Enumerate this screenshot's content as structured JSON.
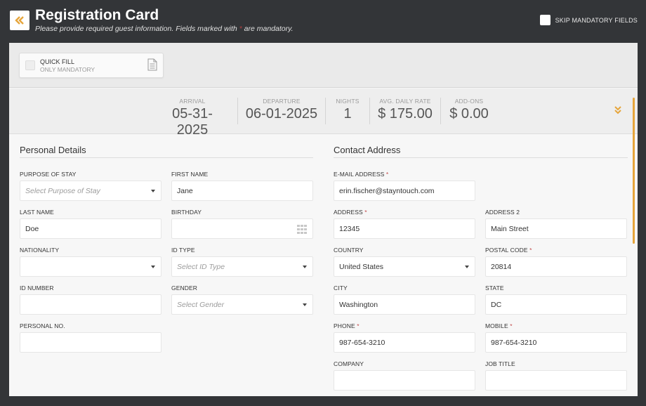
{
  "header": {
    "title": "Registration Card",
    "subtitle_pre": "Please provide required guest information. Fields marked with ",
    "subtitle_star": "*",
    "subtitle_post": " are mandatory.",
    "skip_label": "SKIP MANDATORY FIELDS"
  },
  "quick_fill": {
    "label": "QUICK FILL",
    "sublabel": "ONLY MANDATORY"
  },
  "stay": {
    "arrival": {
      "label": "ARRIVAL",
      "value": "05-31-2025"
    },
    "departure": {
      "label": "DEPARTURE",
      "value": "06-01-2025"
    },
    "nights": {
      "label": "NIGHTS",
      "value": "1"
    },
    "rate": {
      "label": "AVG. DAILY RATE",
      "value": "$ 175.00"
    },
    "addons": {
      "label": "ADD-ONS",
      "value": "$ 0.00"
    }
  },
  "personal": {
    "title": "Personal Details",
    "purpose": {
      "label": "PURPOSE OF STAY",
      "placeholder": "Select Purpose of Stay"
    },
    "first_name": {
      "label": "FIRST NAME",
      "value": "Jane"
    },
    "last_name": {
      "label": "LAST NAME",
      "value": "Doe"
    },
    "birthday": {
      "label": "BIRTHDAY",
      "value": ""
    },
    "nationality": {
      "label": "NATIONALITY",
      "value": ""
    },
    "id_type": {
      "label": "ID TYPE",
      "placeholder": "Select ID Type"
    },
    "id_number": {
      "label": "ID NUMBER",
      "value": ""
    },
    "gender": {
      "label": "GENDER",
      "placeholder": "Select Gender"
    },
    "personal_no": {
      "label": "PERSONAL NO.",
      "value": ""
    }
  },
  "contact": {
    "title": "Contact Address",
    "email": {
      "label": "E-MAIL ADDRESS",
      "value": "erin.fischer@stayntouch.com"
    },
    "address": {
      "label": "ADDRESS",
      "value": "12345"
    },
    "address2": {
      "label": "ADDRESS 2",
      "value": "Main Street"
    },
    "country": {
      "label": "COUNTRY",
      "value": "United States"
    },
    "postal": {
      "label": "POSTAL CODE",
      "value": "20814"
    },
    "city": {
      "label": "CITY",
      "value": "Washington"
    },
    "state": {
      "label": "STATE",
      "value": "DC"
    },
    "phone": {
      "label": "PHONE",
      "value": "987-654-3210"
    },
    "mobile": {
      "label": "MOBILE",
      "value": "987-654-3210"
    },
    "company": {
      "label": "COMPANY",
      "value": ""
    },
    "job_title": {
      "label": "JOB TITLE",
      "value": ""
    }
  },
  "colors": {
    "accent": "#e6a53b",
    "background": "#333538",
    "required": "#c14a4a"
  },
  "icons": {
    "back": "double-chevron-left-icon",
    "expand": "double-chevron-down-icon",
    "document": "document-icon",
    "calendar": "calendar-grid-icon"
  }
}
